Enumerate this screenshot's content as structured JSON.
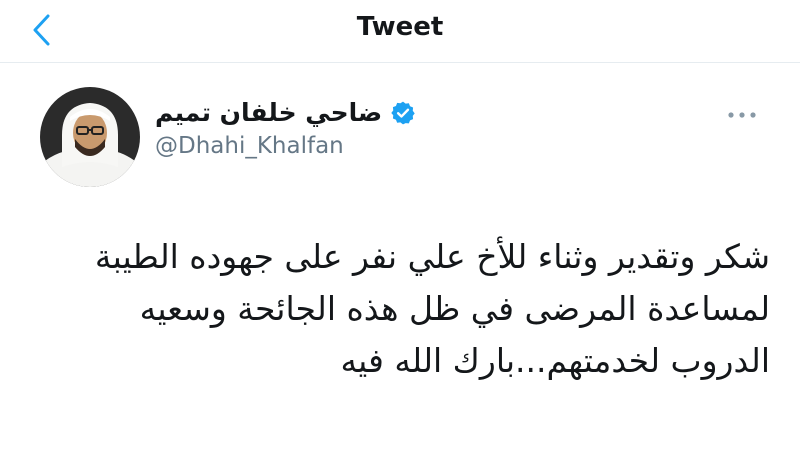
{
  "header": {
    "title": "Tweet",
    "back_icon": "chevron-left-icon"
  },
  "author": {
    "display_name": "ضاحي خلفان تميم",
    "handle": "@Dhahi_Khalfan",
    "verified_icon": "verified-badge-icon"
  },
  "tweet": {
    "text": "شكر وتقدير وثناء للأخ علي نفر على جهوده الطيبة لمساعدة المرضى في ظل هذه الجائحة وسعيه الدروب لخدمتهم...بارك الله فيه"
  },
  "colors": {
    "accent": "#1da1f2",
    "text": "#14171a",
    "secondary": "#657786",
    "divider": "#e6ecf0"
  }
}
